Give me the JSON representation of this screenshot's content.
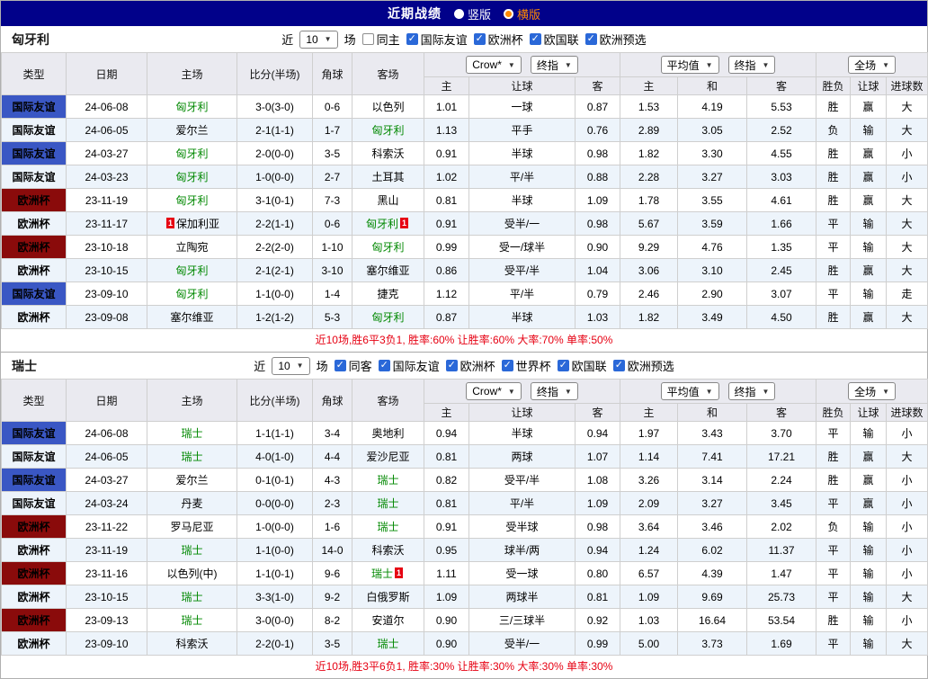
{
  "topbar": {
    "title": "近期战绩",
    "options": [
      {
        "label": "竖版",
        "selected": false
      },
      {
        "label": "横版",
        "selected": true
      }
    ]
  },
  "table_headers": {
    "left": [
      "类型",
      "日期",
      "主场",
      "比分(半场)",
      "角球",
      "客场"
    ],
    "ah_selects": [
      "Crow*",
      "终指"
    ],
    "eu_selects": [
      "平均值",
      "终指"
    ],
    "ft_selects": [
      "全场"
    ],
    "sub": [
      "主",
      "让球",
      "客",
      "主",
      "和",
      "客",
      "胜负",
      "让球",
      "进球数"
    ]
  },
  "colors": {
    "topbar_bg": "#01018a",
    "accent_orange": "#ff8a00",
    "checkbox_blue": "#2a68d8",
    "header_bg": "#eaeaf0",
    "alt_row_bg": "#edf4fb",
    "league_friendly_bg": "#3a57c4",
    "league_cup_bg": "#8a0b0b",
    "team_green": "#008800",
    "score_red": "#e60012",
    "result_red": "#e60012",
    "result_green": "#089b08",
    "result_blue": "#0066cc",
    "red_values": "胜赢大",
    "green_values": "平走负",
    "blue_values": "输小"
  },
  "sections": [
    {
      "team": "匈牙利",
      "filter": {
        "prefix": "近",
        "count": "10",
        "suffix": "场",
        "checkboxes": [
          {
            "label": "同主",
            "checked": false
          },
          {
            "label": "国际友谊",
            "checked": true
          },
          {
            "label": "欧洲杯",
            "checked": true
          },
          {
            "label": "欧国联",
            "checked": true
          },
          {
            "label": "欧洲预选",
            "checked": true
          }
        ]
      },
      "rows": [
        {
          "league": "国际友谊",
          "lk": "friendly",
          "date": "24-06-08",
          "home": "匈牙利",
          "home_self": true,
          "score": "3-0(3-0)",
          "corner": "0-6",
          "away": "以色列",
          "ah": [
            "1.01",
            "一球",
            "0.87"
          ],
          "eu": [
            "1.53",
            "4.19",
            "5.53"
          ],
          "res": [
            "胜",
            "赢",
            "大"
          ]
        },
        {
          "league": "国际友谊",
          "lk": "friendly",
          "date": "24-06-05",
          "home": "爱尔兰",
          "score": "2-1(1-1)",
          "corner": "1-7",
          "away": "匈牙利",
          "away_self": true,
          "ah": [
            "1.13",
            "平手",
            "0.76"
          ],
          "eu": [
            "2.89",
            "3.05",
            "2.52"
          ],
          "res": [
            "负",
            "输",
            "大"
          ]
        },
        {
          "league": "国际友谊",
          "lk": "friendly",
          "date": "24-03-27",
          "home": "匈牙利",
          "home_self": true,
          "score": "2-0(0-0)",
          "corner": "3-5",
          "away": "科索沃",
          "ah": [
            "0.91",
            "半球",
            "0.98"
          ],
          "eu": [
            "1.82",
            "3.30",
            "4.55"
          ],
          "res": [
            "胜",
            "赢",
            "小"
          ]
        },
        {
          "league": "国际友谊",
          "lk": "friendly",
          "date": "24-03-23",
          "home": "匈牙利",
          "home_self": true,
          "score": "1-0(0-0)",
          "corner": "2-7",
          "away": "土耳其",
          "ah": [
            "1.02",
            "平/半",
            "0.88"
          ],
          "eu": [
            "2.28",
            "3.27",
            "3.03"
          ],
          "res": [
            "胜",
            "赢",
            "小"
          ]
        },
        {
          "league": "欧洲杯",
          "lk": "cup",
          "date": "23-11-19",
          "home": "匈牙利",
          "home_self": true,
          "score": "3-1(0-1)",
          "corner": "7-3",
          "away": "黑山",
          "ah": [
            "0.81",
            "半球",
            "1.09"
          ],
          "eu": [
            "1.78",
            "3.55",
            "4.61"
          ],
          "res": [
            "胜",
            "赢",
            "大"
          ]
        },
        {
          "league": "欧洲杯",
          "lk": "cup",
          "date": "23-11-17",
          "home": "保加利亚",
          "home_card": true,
          "score": "2-2(1-1)",
          "corner": "0-6",
          "away": "匈牙利",
          "away_self": true,
          "away_card": true,
          "ah": [
            "0.91",
            "受半/一",
            "0.98"
          ],
          "eu": [
            "5.67",
            "3.59",
            "1.66"
          ],
          "res": [
            "平",
            "输",
            "大"
          ]
        },
        {
          "league": "欧洲杯",
          "lk": "cup",
          "date": "23-10-18",
          "home": "立陶宛",
          "score": "2-2(2-0)",
          "corner": "1-10",
          "away": "匈牙利",
          "away_self": true,
          "ah": [
            "0.99",
            "受一/球半",
            "0.90"
          ],
          "eu": [
            "9.29",
            "4.76",
            "1.35"
          ],
          "res": [
            "平",
            "输",
            "大"
          ]
        },
        {
          "league": "欧洲杯",
          "lk": "cup",
          "date": "23-10-15",
          "home": "匈牙利",
          "home_self": true,
          "score": "2-1(2-1)",
          "corner": "3-10",
          "away": "塞尔维亚",
          "ah": [
            "0.86",
            "受平/半",
            "1.04"
          ],
          "eu": [
            "3.06",
            "3.10",
            "2.45"
          ],
          "res": [
            "胜",
            "赢",
            "大"
          ]
        },
        {
          "league": "国际友谊",
          "lk": "friendly",
          "date": "23-09-10",
          "home": "匈牙利",
          "home_self": true,
          "score": "1-1(0-0)",
          "corner": "1-4",
          "away": "捷克",
          "ah": [
            "1.12",
            "平/半",
            "0.79"
          ],
          "eu": [
            "2.46",
            "2.90",
            "3.07"
          ],
          "res": [
            "平",
            "输",
            "走"
          ]
        },
        {
          "league": "欧洲杯",
          "lk": "cup",
          "date": "23-09-08",
          "home": "塞尔维亚",
          "score": "1-2(1-2)",
          "corner": "5-3",
          "away": "匈牙利",
          "away_self": true,
          "ah": [
            "0.87",
            "半球",
            "1.03"
          ],
          "eu": [
            "1.82",
            "3.49",
            "4.50"
          ],
          "res": [
            "胜",
            "赢",
            "大"
          ]
        }
      ],
      "summary": "近10场,胜6平3负1, 胜率:60% 让胜率:60% 大率:70% 单率:50%"
    },
    {
      "team": "瑞士",
      "filter": {
        "prefix": "近",
        "count": "10",
        "suffix": "场",
        "checkboxes": [
          {
            "label": "同客",
            "checked": true
          },
          {
            "label": "国际友谊",
            "checked": true
          },
          {
            "label": "欧洲杯",
            "checked": true
          },
          {
            "label": "世界杯",
            "checked": true
          },
          {
            "label": "欧国联",
            "checked": true
          },
          {
            "label": "欧洲预选",
            "checked": true
          }
        ]
      },
      "rows": [
        {
          "league": "国际友谊",
          "lk": "friendly",
          "date": "24-06-08",
          "home": "瑞士",
          "home_self": true,
          "score": "1-1(1-1)",
          "corner": "3-4",
          "away": "奥地利",
          "ah": [
            "0.94",
            "半球",
            "0.94"
          ],
          "eu": [
            "1.97",
            "3.43",
            "3.70"
          ],
          "res": [
            "平",
            "输",
            "小"
          ]
        },
        {
          "league": "国际友谊",
          "lk": "friendly",
          "date": "24-06-05",
          "home": "瑞士",
          "home_self": true,
          "score": "4-0(1-0)",
          "corner": "4-4",
          "away": "爱沙尼亚",
          "ah": [
            "0.81",
            "两球",
            "1.07"
          ],
          "eu": [
            "1.14",
            "7.41",
            "17.21"
          ],
          "res": [
            "胜",
            "赢",
            "大"
          ]
        },
        {
          "league": "国际友谊",
          "lk": "friendly",
          "date": "24-03-27",
          "home": "爱尔兰",
          "score": "0-1(0-1)",
          "corner": "4-3",
          "away": "瑞士",
          "away_self": true,
          "ah": [
            "0.82",
            "受平/半",
            "1.08"
          ],
          "eu": [
            "3.26",
            "3.14",
            "2.24"
          ],
          "res": [
            "胜",
            "赢",
            "小"
          ]
        },
        {
          "league": "国际友谊",
          "lk": "friendly",
          "date": "24-03-24",
          "home": "丹麦",
          "score": "0-0(0-0)",
          "corner": "2-3",
          "away": "瑞士",
          "away_self": true,
          "ah": [
            "0.81",
            "平/半",
            "1.09"
          ],
          "eu": [
            "2.09",
            "3.27",
            "3.45"
          ],
          "res": [
            "平",
            "赢",
            "小"
          ]
        },
        {
          "league": "欧洲杯",
          "lk": "cup",
          "date": "23-11-22",
          "home": "罗马尼亚",
          "score": "1-0(0-0)",
          "corner": "1-6",
          "away": "瑞士",
          "away_self": true,
          "ah": [
            "0.91",
            "受半球",
            "0.98"
          ],
          "eu": [
            "3.64",
            "3.46",
            "2.02"
          ],
          "res": [
            "负",
            "输",
            "小"
          ]
        },
        {
          "league": "欧洲杯",
          "lk": "cup",
          "date": "23-11-19",
          "home": "瑞士",
          "home_self": true,
          "score": "1-1(0-0)",
          "corner": "14-0",
          "away": "科索沃",
          "ah": [
            "0.95",
            "球半/两",
            "0.94"
          ],
          "eu": [
            "1.24",
            "6.02",
            "11.37"
          ],
          "res": [
            "平",
            "输",
            "小"
          ]
        },
        {
          "league": "欧洲杯",
          "lk": "cup",
          "date": "23-11-16",
          "home": "以色列(中)",
          "score": "1-1(0-1)",
          "corner": "9-6",
          "away": "瑞士",
          "away_self": true,
          "away_card": true,
          "ah": [
            "1.11",
            "受一球",
            "0.80"
          ],
          "eu": [
            "6.57",
            "4.39",
            "1.47"
          ],
          "res": [
            "平",
            "输",
            "小"
          ]
        },
        {
          "league": "欧洲杯",
          "lk": "cup",
          "date": "23-10-15",
          "home": "瑞士",
          "home_self": true,
          "score": "3-3(1-0)",
          "corner": "9-2",
          "away": "白俄罗斯",
          "ah": [
            "1.09",
            "两球半",
            "0.81"
          ],
          "eu": [
            "1.09",
            "9.69",
            "25.73"
          ],
          "res": [
            "平",
            "输",
            "大"
          ]
        },
        {
          "league": "欧洲杯",
          "lk": "cup",
          "date": "23-09-13",
          "home": "瑞士",
          "home_self": true,
          "score": "3-0(0-0)",
          "corner": "8-2",
          "away": "安道尔",
          "ah": [
            "0.90",
            "三/三球半",
            "0.92"
          ],
          "eu": [
            "1.03",
            "16.64",
            "53.54"
          ],
          "res": [
            "胜",
            "输",
            "小"
          ]
        },
        {
          "league": "欧洲杯",
          "lk": "cup",
          "date": "23-09-10",
          "home": "科索沃",
          "score": "2-2(0-1)",
          "corner": "3-5",
          "away": "瑞士",
          "away_self": true,
          "ah": [
            "0.90",
            "受半/一",
            "0.99"
          ],
          "eu": [
            "5.00",
            "3.73",
            "1.69"
          ],
          "res": [
            "平",
            "输",
            "大"
          ]
        }
      ],
      "summary": "近10场,胜3平6负1, 胜率:30% 让胜率:30% 大率:30% 单率:30%"
    }
  ]
}
